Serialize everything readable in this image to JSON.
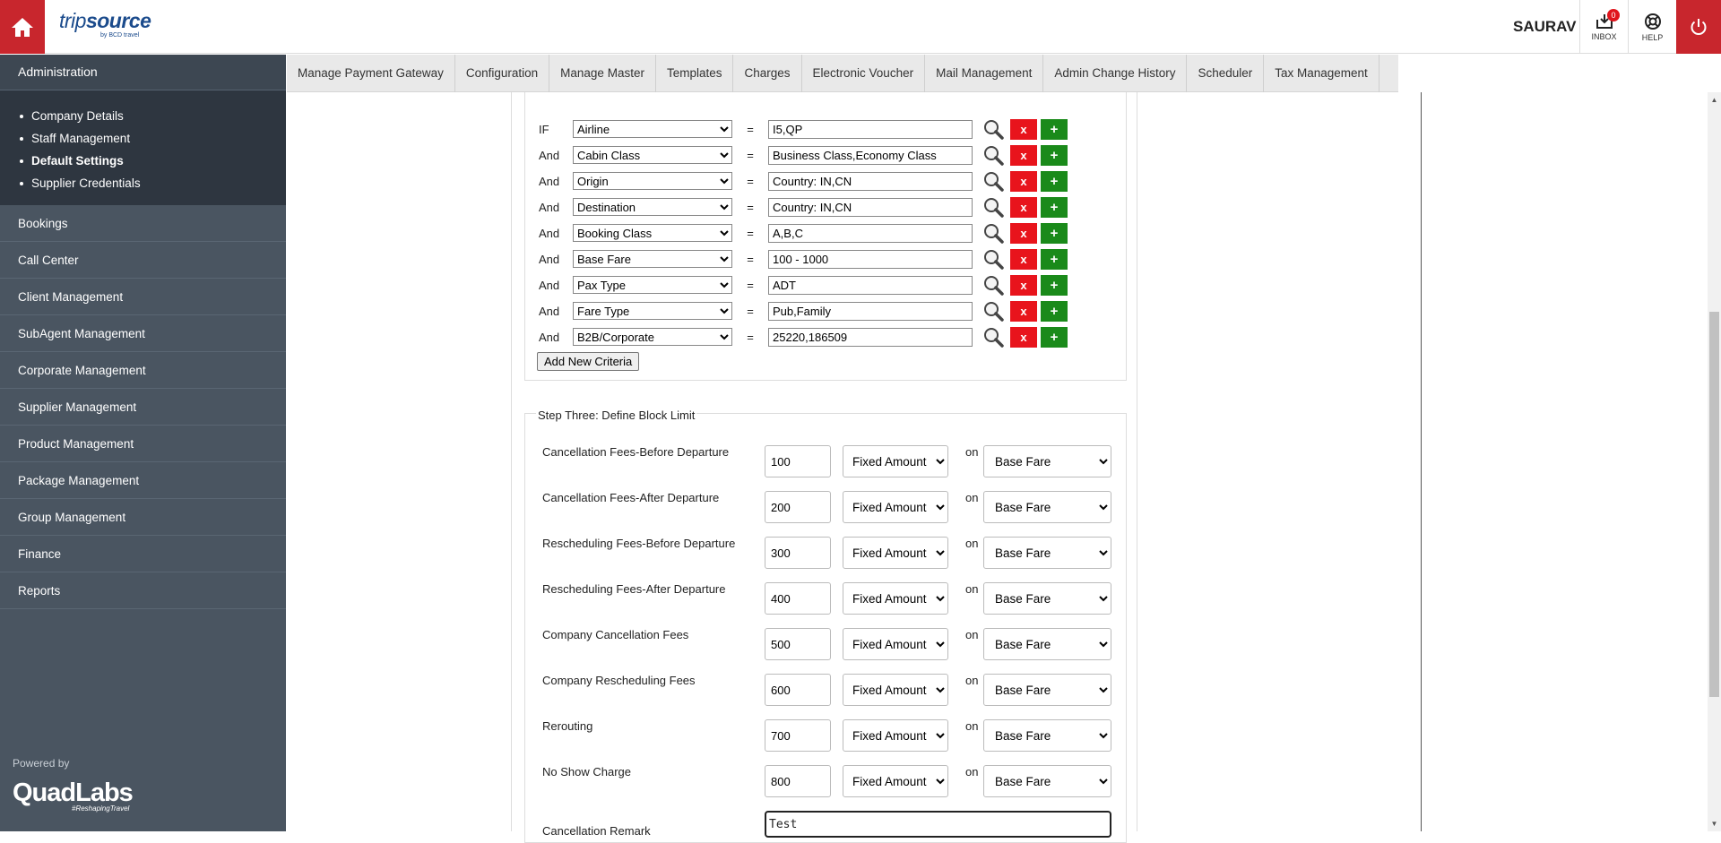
{
  "header": {
    "logo_main_light": "trip",
    "logo_main_bold": "source",
    "logo_sub": "by BCD travel",
    "user": "SAURAV",
    "inbox_label": "INBOX",
    "inbox_count": "0",
    "help_label": "HELP"
  },
  "sidebar": {
    "admin_label": "Administration",
    "admin_items": [
      "Company Details",
      "Staff Management",
      "Default Settings",
      "Supplier Credentials"
    ],
    "items": [
      "Bookings",
      "Call Center",
      "Client Management",
      "SubAgent Management",
      "Corporate Management",
      "Supplier Management",
      "Product Management",
      "Package Management",
      "Group Management",
      "Finance",
      "Reports"
    ],
    "powered_by": "Powered by",
    "brand": "QuadLabs",
    "brand_tag": "#ReshapingTravel"
  },
  "topnav": [
    "Manage Payment Gateway",
    "Configuration",
    "Manage Master",
    "Templates",
    "Charges",
    "Electronic Voucher",
    "Mail Management",
    "Admin Change History",
    "Scheduler",
    "Tax Management"
  ],
  "criteria": {
    "rows": [
      {
        "conn": "IF",
        "field": "Airline",
        "value": "I5,QP"
      },
      {
        "conn": "And",
        "field": "Cabin Class",
        "value": "Business Class,Economy Class"
      },
      {
        "conn": "And",
        "field": "Origin",
        "value": "Country: IN,CN"
      },
      {
        "conn": "And",
        "field": "Destination",
        "value": "Country: IN,CN"
      },
      {
        "conn": "And",
        "field": "Booking Class",
        "value": "A,B,C"
      },
      {
        "conn": "And",
        "field": "Base Fare",
        "value": "100 - 1000"
      },
      {
        "conn": "And",
        "field": "Pax Type",
        "value": "ADT"
      },
      {
        "conn": "And",
        "field": "Fare Type",
        "value": "Pub,Family"
      },
      {
        "conn": "And",
        "field": "B2B/Corporate",
        "value": "25220,186509"
      }
    ],
    "eq": "=",
    "remove_label": "x",
    "add_label": "+",
    "add_new_label": "Add New Criteria"
  },
  "step3": {
    "legend": "Step Three: Define Block Limit",
    "on_label": "on",
    "rows": [
      {
        "label": "Cancellation Fees-Before Departure",
        "value": "100",
        "type": "Fixed Amount",
        "base": "Base Fare"
      },
      {
        "label": "Cancellation Fees-After Departure",
        "value": "200",
        "type": "Fixed Amount",
        "base": "Base Fare"
      },
      {
        "label": "Rescheduling Fees-Before Departure",
        "value": "300",
        "type": "Fixed Amount",
        "base": "Base Fare"
      },
      {
        "label": "Rescheduling Fees-After Departure",
        "value": "400",
        "type": "Fixed Amount",
        "base": "Base Fare"
      },
      {
        "label": "Company Cancellation Fees",
        "value": "500",
        "type": "Fixed Amount",
        "base": "Base Fare"
      },
      {
        "label": "Company Rescheduling Fees",
        "value": "600",
        "type": "Fixed Amount",
        "base": "Base Fare"
      },
      {
        "label": "Rerouting",
        "value": "700",
        "type": "Fixed Amount",
        "base": "Base Fare"
      },
      {
        "label": "No Show Charge",
        "value": "800",
        "type": "Fixed Amount",
        "base": "Base Fare"
      }
    ],
    "remark_label": "Cancellation Remark",
    "remark_value": "Test"
  },
  "colors": {
    "brand_red": "#c8262d",
    "remove_red": "#e8141c",
    "add_green": "#1a8a1a",
    "sidebar": "#4a5561"
  }
}
